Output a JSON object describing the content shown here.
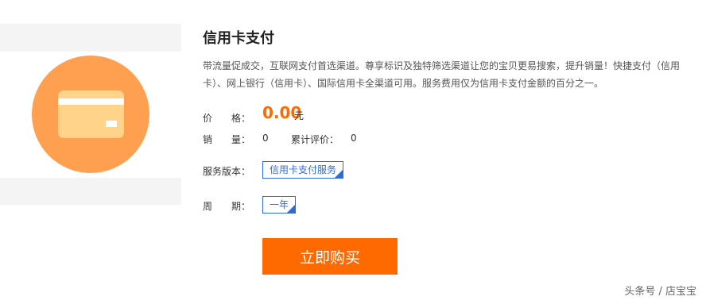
{
  "product": {
    "title": "信用卡支付",
    "description": "带流量促成交，互联网支付首选渠道。尊享标识及独特筛选渠道让您的宝贝更易搜索，提升销量！快捷支付（信用卡）、网上银行（信用卡）、国际信用卡全渠道可用。服务费用仅为信用卡支付金额的百分之一。",
    "icon": "credit-card-icon",
    "icon_colors": {
      "circle": "#ff9f50",
      "card": "#ffd38a"
    }
  },
  "price": {
    "label": "价　　格：",
    "value": "0.00",
    "unit": "元"
  },
  "sales": {
    "label": "销　　量：",
    "value": "0",
    "review_label": "累计评价：",
    "review_value": "0"
  },
  "edition": {
    "label": "服务版本：",
    "selected": "信用卡支付服务"
  },
  "period": {
    "label": "周　　期：",
    "selected": "一年"
  },
  "buy_button": {
    "label": "立即购买",
    "color": "#ff6a00"
  },
  "watermark": "头条号 / 店宝宝"
}
